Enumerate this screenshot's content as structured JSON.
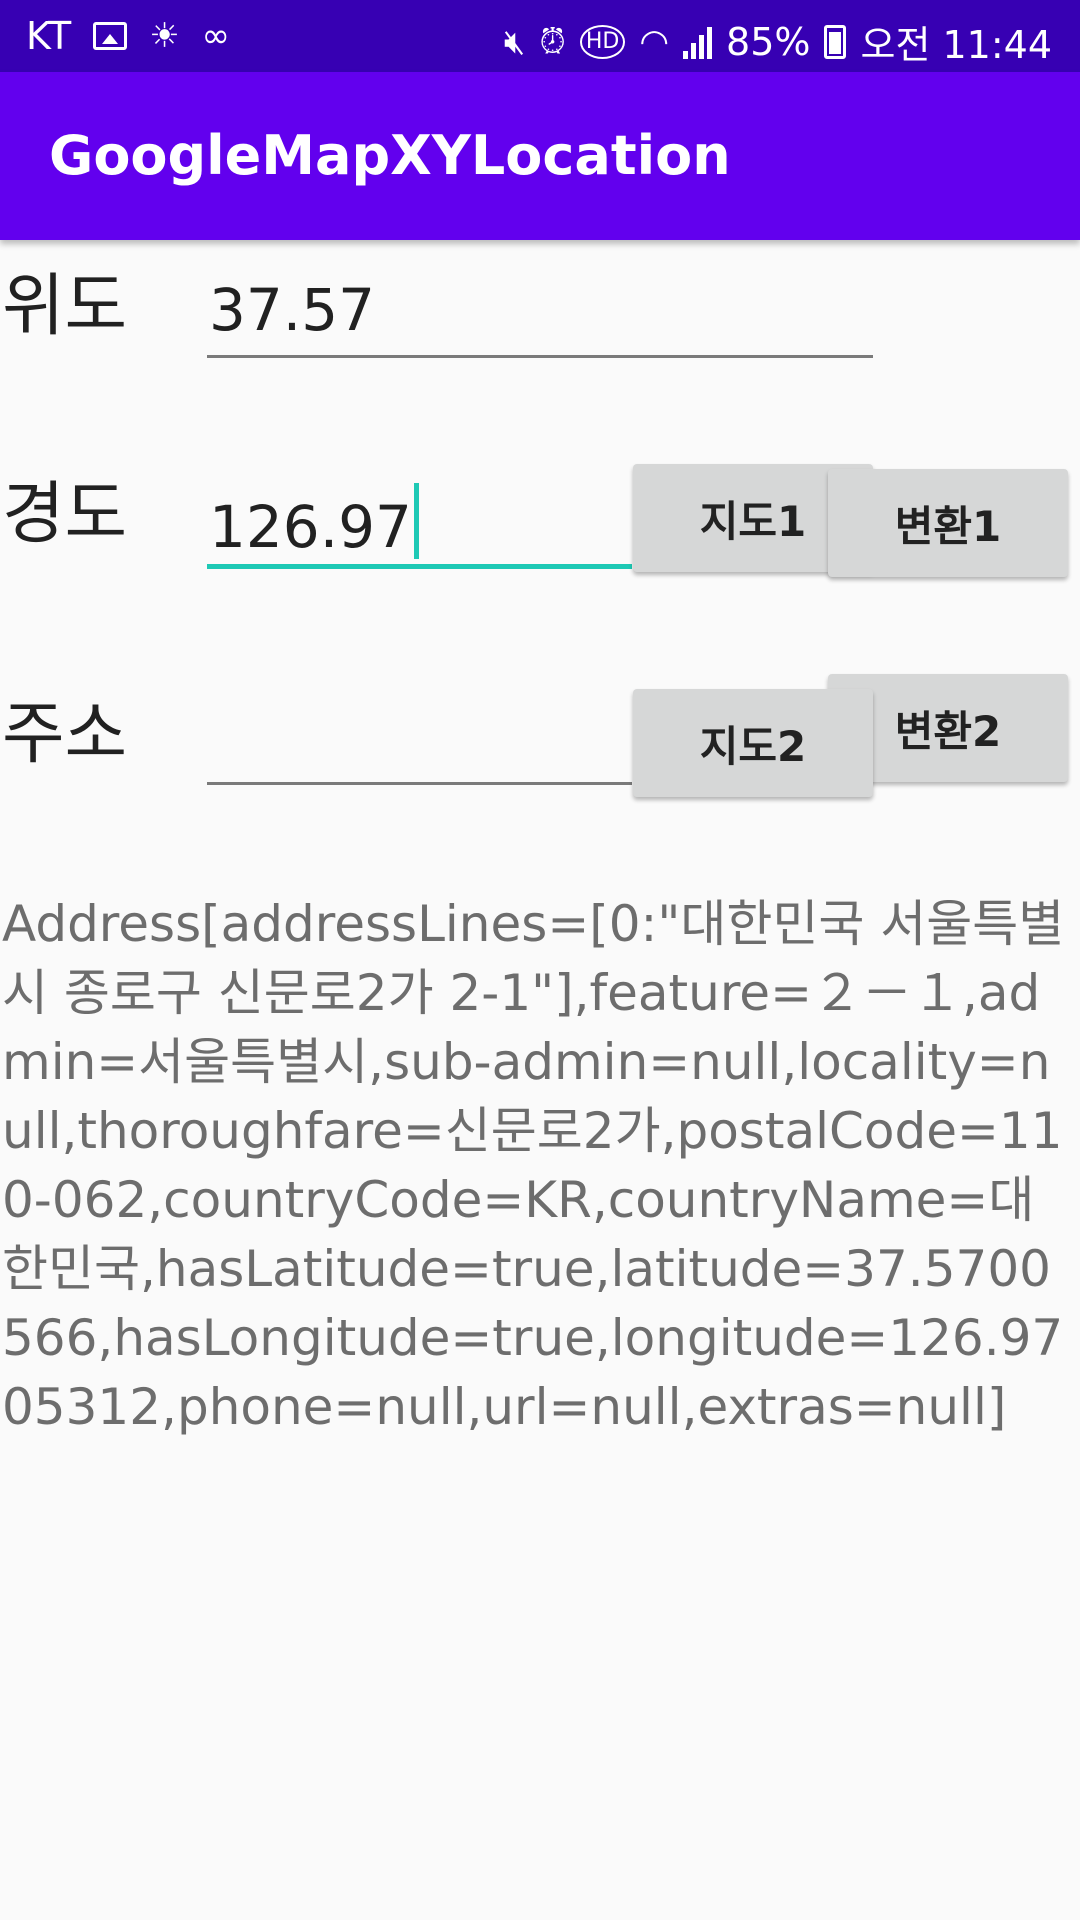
{
  "status_bar": {
    "carrier": "KT",
    "battery": "85%",
    "time": "오전 11:44",
    "icons": [
      "image-icon",
      "weather-icon",
      "link-icon",
      "mute-icon",
      "alarm-icon",
      "hd-icon",
      "wifi-icon",
      "signal-icon",
      "battery-icon"
    ]
  },
  "app_bar": {
    "title": "GoogleMapXYLocation"
  },
  "form": {
    "latitude_label": "위도",
    "latitude_value": "37.57",
    "longitude_label": "경도",
    "longitude_value": "126.97",
    "address_label": "주소",
    "address_value": ""
  },
  "buttons": {
    "map1": "지도1",
    "convert1": "변환1",
    "map2": "지도2",
    "convert2": "변환2"
  },
  "result_text": "Address[addressLines=[0:\"대한민국 서울특별시 종로구 신문로2가 2-1\"],feature=２－１,admin=서울특별시,sub-admin=null,locality=null,thoroughfare=신문로2가,postalCode=110-062,countryCode=KR,countryName=대한민국,hasLatitude=true,latitude=37.5700566,hasLongitude=true,longitude=126.9705312,phone=null,url=null,extras=null]",
  "colors": {
    "status_bar": "#3700b3",
    "app_bar": "#6200ee",
    "accent": "#1ec9b5",
    "button": "#d6d7d7"
  }
}
